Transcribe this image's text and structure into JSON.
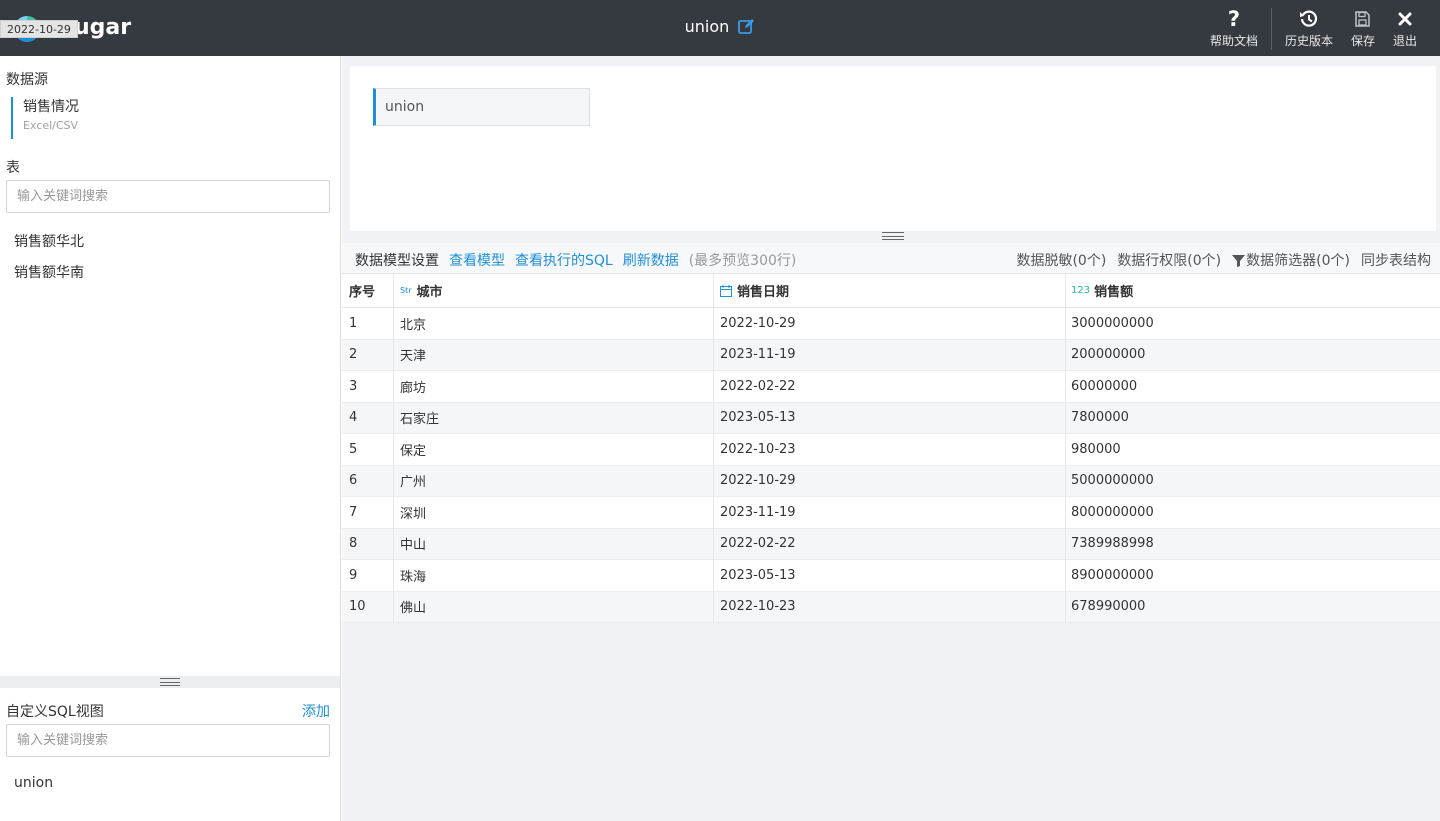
{
  "header": {
    "logo_text": "ugar",
    "date_tip": "2022-10-29",
    "title": "union",
    "tools": [
      {
        "label": "帮助文档",
        "icon": "help-icon"
      },
      {
        "label": "历史版本",
        "icon": "history-icon"
      },
      {
        "label": "保存",
        "icon": "save-icon"
      },
      {
        "label": "退出",
        "icon": "close-icon"
      }
    ]
  },
  "sidebar": {
    "datasource_label": "数据源",
    "datasource": {
      "name": "销售情况",
      "type": "Excel/CSV"
    },
    "tables_label": "表",
    "tables_search_placeholder": "输入关键词搜索",
    "tables": [
      "销售额华北",
      "销售额华南"
    ],
    "sql_views_label": "自定义SQL视图",
    "sql_add_label": "添加",
    "sql_search_placeholder": "输入关键词搜索",
    "sql_views": [
      "union"
    ]
  },
  "canvas": {
    "node_label": "union"
  },
  "toolbar": {
    "model_settings": "数据模型设置",
    "view_model": "查看模型",
    "view_sql": "查看执行的SQL",
    "refresh": "刷新数据",
    "preview_note": "(最多预览300行)",
    "masking": "数据脱敏(0个)",
    "row_permission": "数据行权限(0个)",
    "filter": "数据筛选器(0个)",
    "sync": "同步表结构"
  },
  "grid": {
    "headers": {
      "index": "序号",
      "city": "城市",
      "city_type": "Str",
      "date": "销售日期",
      "amount": "销售额",
      "amount_type": "123"
    },
    "rows": [
      [
        "1",
        "北京",
        "2022-10-29",
        "3000000000"
      ],
      [
        "2",
        "天津",
        "2023-11-19",
        "200000000"
      ],
      [
        "3",
        "廊坊",
        "2022-02-22",
        "60000000"
      ],
      [
        "4",
        "石家庄",
        "2023-05-13",
        "7800000"
      ],
      [
        "5",
        "保定",
        "2022-10-23",
        "980000"
      ],
      [
        "6",
        "广州",
        "2022-10-29",
        "5000000000"
      ],
      [
        "7",
        "深圳",
        "2023-11-19",
        "8000000000"
      ],
      [
        "8",
        "中山",
        "2022-02-22",
        "7389988998"
      ],
      [
        "9",
        "珠海",
        "2023-05-13",
        "8900000000"
      ],
      [
        "10",
        "佛山",
        "2022-10-23",
        "678990000"
      ]
    ]
  }
}
